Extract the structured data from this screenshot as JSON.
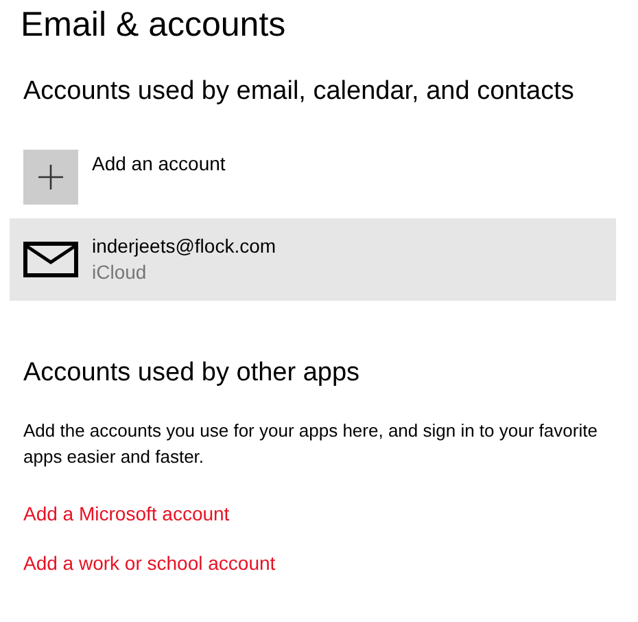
{
  "page_title": "Email & accounts",
  "email_section": {
    "heading": "Accounts used by email, calendar, and contacts",
    "add_button": {
      "label": "Add an account"
    },
    "accounts": [
      {
        "address": "inderjeets@flock.com",
        "provider": "iCloud",
        "selected": true
      }
    ]
  },
  "other_apps_section": {
    "heading": "Accounts used by other apps",
    "description": "Add the accounts you use for your apps here, and sign in to your favorite apps easier and faster.",
    "links": [
      "Add a Microsoft account",
      "Add a work or school account"
    ]
  }
}
